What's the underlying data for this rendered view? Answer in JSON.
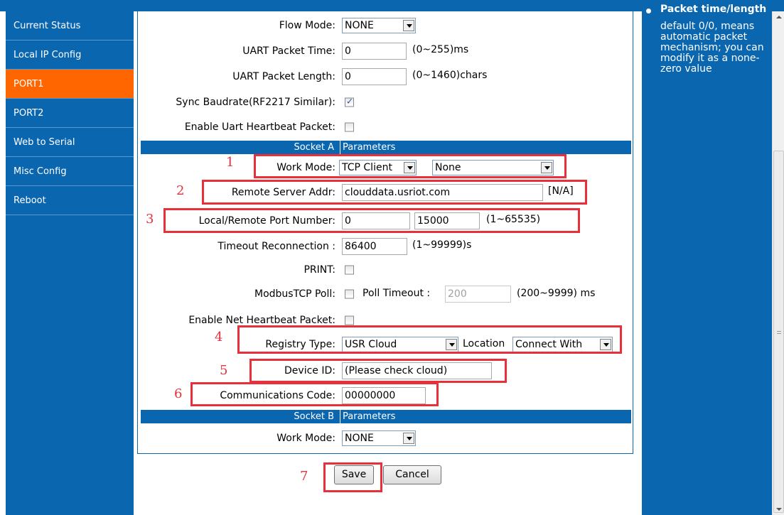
{
  "sidebar": {
    "items": [
      {
        "label": "Current Status"
      },
      {
        "label": "Local IP Config"
      },
      {
        "label": "PORT1"
      },
      {
        "label": "PORT2"
      },
      {
        "label": "Web to Serial"
      },
      {
        "label": "Misc Config"
      },
      {
        "label": "Reboot"
      }
    ],
    "active_index": 2
  },
  "form": {
    "flow_mode": {
      "label": "Flow Mode:",
      "value": "NONE"
    },
    "uart_packet_time": {
      "label": "UART Packet Time:",
      "value": "0",
      "hint": "(0~255)ms"
    },
    "uart_packet_length": {
      "label": "UART Packet Length:",
      "value": "0",
      "hint": "(0~1460)chars"
    },
    "sync_baudrate": {
      "label": "Sync Baudrate(RF2217 Similar):",
      "checked": true
    },
    "enable_uart_heartbeat": {
      "label": "Enable Uart Heartbeat Packet:",
      "checked": false
    },
    "socket_a": {
      "left": "Socket A",
      "right": "Parameters"
    },
    "work_mode": {
      "label": "Work Mode:",
      "value": "TCP Client",
      "value2": "None"
    },
    "remote_server": {
      "label": "Remote Server Addr:",
      "value": "clouddata.usriot.com",
      "hint": "[N/A]"
    },
    "port_number": {
      "label": "Local/Remote Port Number:",
      "local": "0",
      "remote": "15000",
      "hint": "(1~65535)"
    },
    "timeout_reconnection": {
      "label": "Timeout Reconnection :",
      "value": "86400",
      "hint": "(1~99999)s"
    },
    "print": {
      "label": "PRINT:",
      "checked": false
    },
    "modbus_poll": {
      "label": "ModbusTCP Poll:",
      "checked": false,
      "timeout_label": "Poll Timeout :",
      "timeout_value": "200",
      "hint": "(200~9999) ms"
    },
    "enable_net_heartbeat": {
      "label": "Enable Net Heartbeat Packet:",
      "checked": false
    },
    "registry_type": {
      "label": "Registry Type:",
      "value": "USR Cloud",
      "location_label": "Location",
      "location_value": "Connect With"
    },
    "device_id": {
      "label": "Device ID:",
      "value": "(Please check cloud)"
    },
    "communications_code": {
      "label": "Communications Code:",
      "value": "00000000"
    },
    "socket_b": {
      "left": "Socket B",
      "right": "Parameters"
    },
    "work_mode_b": {
      "label": "Work Mode:",
      "value": "NONE"
    }
  },
  "buttons": {
    "save": "Save",
    "cancel": "Cancel"
  },
  "annotations": [
    "1",
    "2",
    "3",
    "4",
    "5",
    "6",
    "7"
  ],
  "help": {
    "title": "Packet time/length",
    "body": "default 0/0, means automatic packet mechanism; you can modify it as a none-zero value"
  },
  "colors": {
    "accent_blue": "#0b66b0",
    "active_orange": "#ff6600",
    "annotation_red": "#e8303a"
  }
}
